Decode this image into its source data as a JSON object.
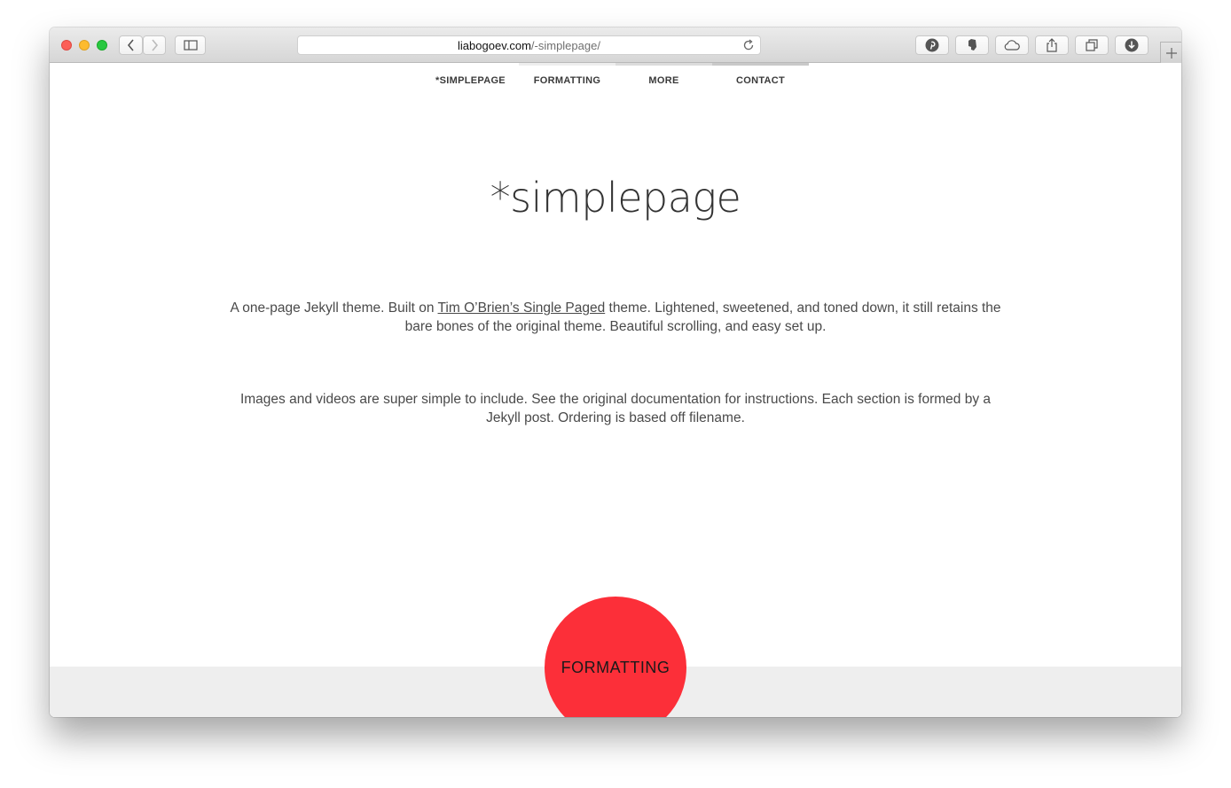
{
  "browser": {
    "url_host": "liabogoev.com",
    "url_path": "/-simplepage/",
    "toolbar_icons": [
      "back-icon",
      "forward-icon",
      "sidebar-icon",
      "reload-icon",
      "pinterest-icon",
      "evernote-icon",
      "cloud-icon",
      "share-icon",
      "tabs-icon",
      "downloads-icon",
      "new-tab-icon"
    ]
  },
  "nav": {
    "items": [
      {
        "label": "*SIMPLEPAGE",
        "color": "#ffffff"
      },
      {
        "label": "FORMATTING",
        "color": "#eeeeee"
      },
      {
        "label": "MORE",
        "color": "#dcdcdc"
      },
      {
        "label": "CONTACT",
        "color": "#c9c9c9"
      }
    ]
  },
  "hero": {
    "title": "*simplepage"
  },
  "intro": {
    "p1_before": "A one-page Jekyll theme. Built on ",
    "p1_link": "Tim O’Brien’s Single Paged",
    "p1_after": " theme. Lightened, sweetened, and toned down, it still retains the bare bones of the original theme. Beautiful scrolling, and easy set up.",
    "p2": "Images and videos are super simple to include. See the original documentation for instructions. Each section is formed by a Jekyll post. Ordering is based off filename."
  },
  "next_section": {
    "label": "FORMATTING",
    "color": "#fc2f39"
  }
}
